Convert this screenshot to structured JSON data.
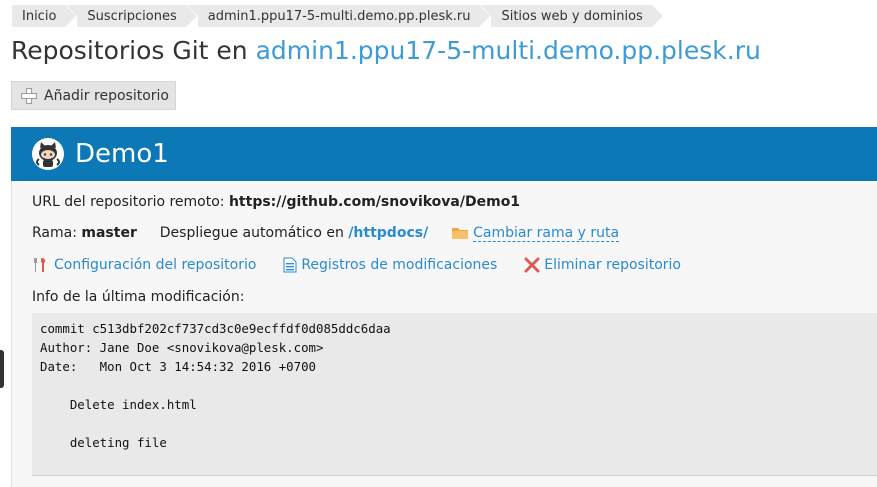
{
  "breadcrumb": {
    "items": [
      {
        "label": "Inicio"
      },
      {
        "label": "Suscripciones"
      },
      {
        "label": "admin1.ppu17-5-multi.demo.pp.plesk.ru"
      },
      {
        "label": "Sitios web y dominios"
      }
    ]
  },
  "page": {
    "title_prefix": "Repositorios Git en ",
    "title_domain": "admin1.ppu17-5-multi.demo.pp.plesk.ru"
  },
  "toolbar": {
    "add_label": "Añadir repositorio"
  },
  "repo": {
    "name": "Demo1",
    "remote_url_label": "URL del repositorio remoto:",
    "remote_url": "https://github.com/snovikova/Demo1",
    "branch_label": "Rama:",
    "branch": "master",
    "deploy_label": "Despliegue automático en",
    "deploy_path": "/httpdocs/",
    "change_branch_label": "Cambiar rama y ruta",
    "actions": {
      "config_label": "Configuración del repositorio",
      "logs_label": "Registros de modificaciones",
      "delete_label": "Eliminar repositorio"
    },
    "last_commit_label": "Info de la última modificación:",
    "commit_text": "commit c513dbf202cf737cd3c0e9ecffdf0d085ddc6daa\nAuthor: Jane Doe <snovikova@plesk.com>\nDate:   Mon Oct 3 14:54:32 2016 +0700\n\n    Delete index.html\n\n    deleting file"
  },
  "colors": {
    "header_bg": "#0c78b5",
    "link": "#2a8bd0",
    "title_domain": "#3e9bd6",
    "delete_icon": "#e05a4f",
    "folder_icon": "#f0a93b"
  }
}
